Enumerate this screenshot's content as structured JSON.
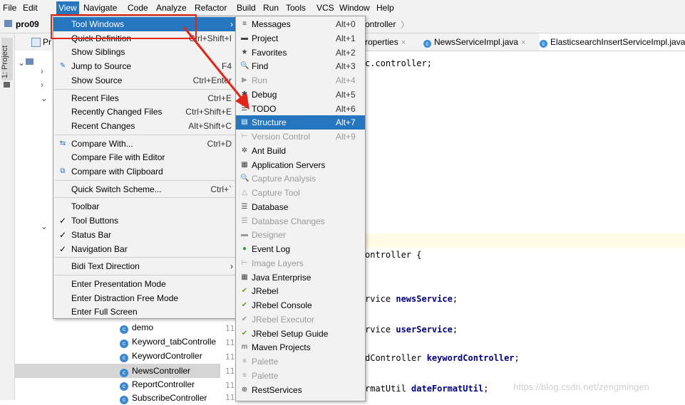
{
  "menubar": {
    "items": [
      "File",
      "Edit",
      "View",
      "Navigate",
      "Code",
      "Analyze",
      "Refactor",
      "Build",
      "Run",
      "Tools",
      "VCS",
      "Window",
      "Help"
    ]
  },
  "navbar": {
    "project": "pro09",
    "crumb": "ontroller"
  },
  "tabs": [
    {
      "label": "roperties"
    },
    {
      "label": "NewsServiceImpl.java"
    },
    {
      "label": "ElasticsearchInsertServiceImpl.java"
    }
  ],
  "side_strip": {
    "label": "1: Project"
  },
  "tree": {
    "header": "Pr",
    "items": [
      "demo",
      "Keyword_tabControlle",
      "KeywordController",
      "NewsController",
      "ReportController",
      "SubscribeController"
    ]
  },
  "line_numbers": [
    "11",
    "11",
    "11",
    "11",
    "11",
    "11"
  ],
  "editor": {
    "lines": [
      {
        "pre": "c.controller;",
        "bold": ""
      },
      {
        "pre": "ontroller {",
        "bold": ""
      },
      {
        "pre": "rvice ",
        "bold": "newsService",
        "post": ";"
      },
      {
        "pre": "rvice ",
        "bold": "userService",
        "post": ";"
      },
      {
        "pre": "dController ",
        "bold": "keywordController",
        "post": ";"
      },
      {
        "pre": "rmatUtil ",
        "bold": "dateFormatUtil",
        "post": ";"
      }
    ]
  },
  "view_menu": {
    "items": [
      {
        "label": "Tool Windows",
        "shortcut": "",
        "submenu": true,
        "highlight": true
      },
      {
        "label": "Quick Definition",
        "shortcut": "Ctrl+Shift+I"
      },
      {
        "label": "Show Siblings",
        "shortcut": ""
      },
      {
        "label": "Jump to Source",
        "shortcut": "F4",
        "icon": "pencil-icon"
      },
      {
        "label": "Show Source",
        "shortcut": "Ctrl+Enter"
      },
      {
        "label": "Recent Files",
        "shortcut": "Ctrl+E",
        "sep_before": true
      },
      {
        "label": "Recently Changed Files",
        "shortcut": "Ctrl+Shift+E"
      },
      {
        "label": "Recent Changes",
        "shortcut": "Alt+Shift+C"
      },
      {
        "label": "Compare With...",
        "shortcut": "Ctrl+D",
        "sep_before": true,
        "icon": "compare-icon"
      },
      {
        "label": "Compare File with Editor",
        "shortcut": ""
      },
      {
        "label": "Compare with Clipboard",
        "shortcut": "",
        "icon": "clipboard-compare-icon"
      },
      {
        "label": "Quick Switch Scheme...",
        "shortcut": "Ctrl+`",
        "sep_before": true
      },
      {
        "label": "Toolbar",
        "shortcut": "",
        "sep_before": true
      },
      {
        "label": "Tool Buttons",
        "shortcut": "",
        "checked": true
      },
      {
        "label": "Status Bar",
        "shortcut": "",
        "checked": true
      },
      {
        "label": "Navigation Bar",
        "shortcut": "",
        "checked": true
      },
      {
        "label": "Bidi Text Direction",
        "shortcut": "",
        "submenu": true,
        "sep_before": true
      },
      {
        "label": "Enter Presentation Mode",
        "shortcut": "",
        "sep_before": true
      },
      {
        "label": "Enter Distraction Free Mode",
        "shortcut": ""
      },
      {
        "label": "Enter Full Screen",
        "shortcut": ""
      }
    ]
  },
  "tool_windows_menu": {
    "items": [
      {
        "label": "Messages",
        "shortcut": "Alt+0",
        "icon": "≡"
      },
      {
        "label": "Project",
        "shortcut": "Alt+1",
        "icon": "▬"
      },
      {
        "label": "Favorites",
        "shortcut": "Alt+2",
        "icon": "★"
      },
      {
        "label": "Find",
        "shortcut": "Alt+3",
        "icon": "🔍"
      },
      {
        "label": "Run",
        "shortcut": "Alt+4",
        "icon": "▶",
        "disabled": true
      },
      {
        "label": "Debug",
        "shortcut": "Alt+5",
        "icon": "✱"
      },
      {
        "label": "TODO",
        "shortcut": "Alt+6",
        "icon": "☰"
      },
      {
        "label": "Structure",
        "shortcut": "Alt+7",
        "icon": "▤",
        "highlight": true
      },
      {
        "label": "Version Control",
        "shortcut": "Alt+9",
        "icon": "⊢",
        "disabled": true
      },
      {
        "label": "Ant Build",
        "shortcut": "",
        "icon": "✲"
      },
      {
        "label": "Application Servers",
        "shortcut": "",
        "icon": "▦"
      },
      {
        "label": "Capture Analysis",
        "shortcut": "",
        "icon": "🔍",
        "disabled": true
      },
      {
        "label": "Capture Tool",
        "shortcut": "",
        "icon": "△",
        "disabled": true
      },
      {
        "label": "Database",
        "shortcut": "",
        "icon": "☰"
      },
      {
        "label": "Database Changes",
        "shortcut": "",
        "icon": "☰",
        "disabled": true
      },
      {
        "label": "Designer",
        "shortcut": "",
        "icon": "▬",
        "disabled": true
      },
      {
        "label": "Event Log",
        "shortcut": "",
        "icon": "●"
      },
      {
        "label": "Image Layers",
        "shortcut": "",
        "icon": "⊢",
        "disabled": true
      },
      {
        "label": "Java Enterprise",
        "shortcut": "",
        "icon": "▦"
      },
      {
        "label": "JRebel",
        "shortcut": "",
        "icon": "✔"
      },
      {
        "label": "JRebel Console",
        "shortcut": "",
        "icon": "✔"
      },
      {
        "label": "JRebel Executor",
        "shortcut": "",
        "icon": "✔",
        "disabled": true
      },
      {
        "label": "JRebel Setup Guide",
        "shortcut": "",
        "icon": "✔"
      },
      {
        "label": "Maven Projects",
        "shortcut": "",
        "icon": "m"
      },
      {
        "label": "Palette",
        "shortcut": "",
        "icon": "≡",
        "disabled": true
      },
      {
        "label": "Palette",
        "shortcut": "",
        "icon": "≡",
        "disabled": true
      },
      {
        "label": "RestServices",
        "shortcut": "",
        "icon": "⊕"
      }
    ]
  },
  "watermark": "https://blog.csdn.net/zengmingen",
  "colors": {
    "highlight": "#2675bf",
    "annotation": "#e3241b"
  }
}
